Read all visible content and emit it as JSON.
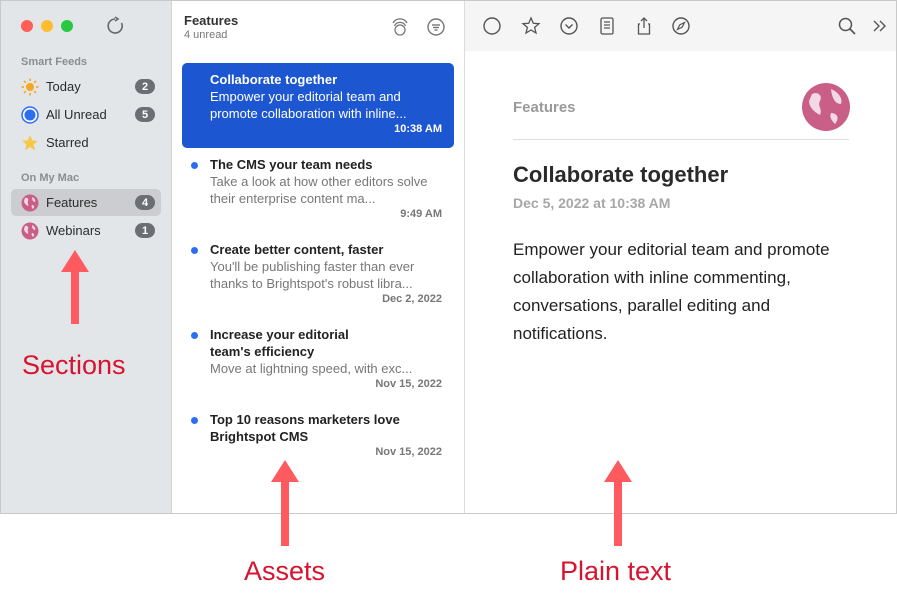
{
  "sidebar": {
    "smart_feeds_label": "Smart Feeds",
    "on_my_mac_label": "On My Mac",
    "items": [
      {
        "label": "Today",
        "badge": "2",
        "icon": "sun-icon"
      },
      {
        "label": "All Unread",
        "badge": "5",
        "icon": "unread-circle-icon"
      },
      {
        "label": "Starred",
        "badge": "",
        "icon": "star-icon"
      },
      {
        "label": "Features",
        "badge": "4",
        "icon": "globe-icon"
      },
      {
        "label": "Webinars",
        "badge": "1",
        "icon": "globe-icon"
      }
    ]
  },
  "list": {
    "title": "Features",
    "subtitle": "4 unread",
    "articles": [
      {
        "title": "Collaborate together",
        "snippet": "Empower your editorial team and promote collaboration with inline...",
        "date": "10:38 AM"
      },
      {
        "title": "The CMS your team needs",
        "snippet": "Take a look at how other editors solve their enterprise content ma...",
        "date": "9:49 AM"
      },
      {
        "title": "Create better content, faster",
        "snippet": "You'll be publishing faster than ever thanks to Brightspot's robust libra...",
        "date": "Dec 2, 2022"
      },
      {
        "title": "Increase your editorial team's efficiency",
        "snippet": "Move at lightning speed, with exc...",
        "date": "Nov 15, 2022"
      },
      {
        "title": "Top 10 reasons marketers love Brightspot CMS",
        "snippet": "",
        "date": "Nov 15, 2022"
      }
    ]
  },
  "reader": {
    "feed": "Features",
    "title": "Collaborate together",
    "date": "Dec 5, 2022 at 10:38 AM",
    "body": "Empower your editorial team and promote collaboration with inline commenting, conversations, parallel editing and notifications."
  },
  "annotations": {
    "sections": "Sections",
    "assets": "Assets",
    "plain_text": "Plain text"
  },
  "colors": {
    "selection_blue": "#1d56d1",
    "unread_dot": "#2c6ef2",
    "annotation_red": "#d8132f",
    "arrow_red": "#ff5a5f",
    "globe_pink": "#c95f87"
  }
}
